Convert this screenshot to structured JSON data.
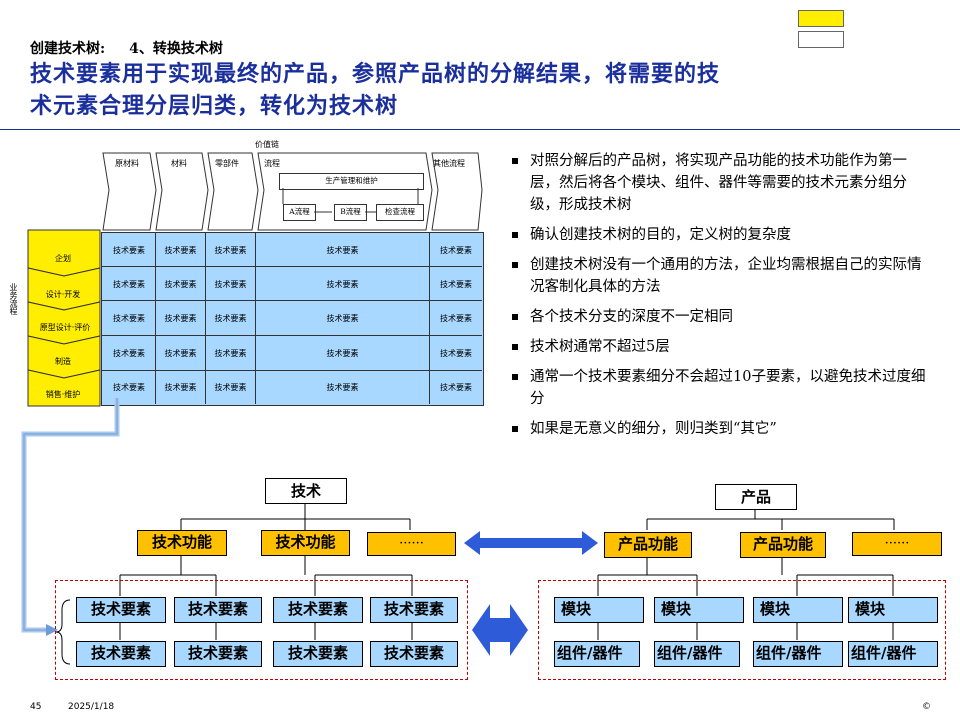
{
  "header": {
    "kicker_left": "创建技术树:",
    "kicker_right": "4、转换技术树",
    "title_line1": "技术要素用于实现最终的产品，参照产品树的分解结果，将需要的技",
    "title_line2": "术元素合理分层归类，转化为技术树"
  },
  "matrix": {
    "value_chain_label": "价值链",
    "columns": [
      "原材料",
      "材料",
      "零部件",
      "流程",
      "其他流程"
    ],
    "production_box": "生产管理和维护",
    "process_boxes": [
      "A流程",
      "B流程",
      "检查流程"
    ],
    "rows": [
      "企划",
      "设计·开发",
      "原型设计·评价",
      "制造",
      "销售·维护"
    ],
    "cell_text": "技术要素",
    "side_label": "业务流程"
  },
  "bullets": [
    "对照分解后的产品树，将实现产品功能的技术功能作为第一层，然后将各个模块、组件、器件等需要的技术元素分组分级，形成技术树",
    "确认创建技术树的目的，定义树的复杂度",
    "创建技术树没有一个通用的方法，企业均需根据自己的实际情况客制化具体的方法",
    "各个技术分支的深度不一定相同",
    "技术树通常不超过5层",
    "通常一个技术要素细分不会超过10子要素，以避免技术过度细分",
    "如果是无意义的细分，则归类到“其它”"
  ],
  "tech_tree": {
    "root": "技术",
    "functions": [
      "技术功能",
      "技术功能",
      "······"
    ],
    "elements_top": [
      "技术要素",
      "技术要素",
      "技术要素",
      "技术要素"
    ],
    "elements_bottom": [
      "技术要素",
      "技术要素",
      "技术要素",
      "技术要素"
    ]
  },
  "product_tree": {
    "root": "产品",
    "functions": [
      "产品功能",
      "产品功能",
      "······"
    ],
    "modules": [
      "模块",
      "模块",
      "模块",
      "模块"
    ],
    "components": [
      "组件/器件",
      "组件/器件",
      "组件/器件",
      "组件/器件"
    ]
  },
  "footer": {
    "page": "45",
    "date": "2025/1/18",
    "copyright": "©"
  },
  "colors": {
    "title_blue": "#1a2f9c",
    "matrix_blue": "#a8d8ff",
    "row_yellow": "#ffee00",
    "function_orange": "#ffc000",
    "dashed_red": "#c00000",
    "arrow_blue": "#2e5bd8"
  }
}
